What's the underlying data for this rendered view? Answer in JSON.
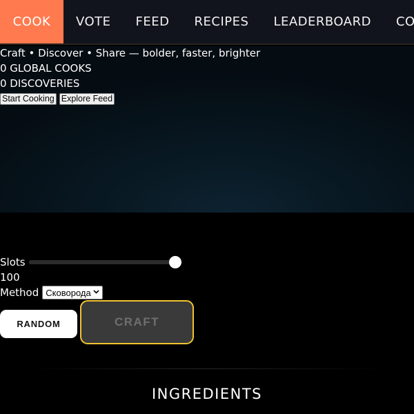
{
  "nav": {
    "tabs": [
      {
        "label": "COOK",
        "active": true
      },
      {
        "label": "VOTE",
        "active": false
      },
      {
        "label": "FEED",
        "active": false
      },
      {
        "label": "RECIPES",
        "active": false
      },
      {
        "label": "LEADERBOARD",
        "active": false
      },
      {
        "label": "COMMUNITY",
        "active": false
      }
    ],
    "active_color": "#ff7a4e"
  },
  "hero": {
    "tagline": "Craft • Discover • Share — bolder, faster, brighter",
    "global_cooks": "0 GLOBAL COOKS",
    "discoveries": "0 DISCOVERIES",
    "start_button": "Start Cooking",
    "explore_button": "Explore Feed"
  },
  "controls": {
    "slots_label": "Slots",
    "slots_value": "100",
    "slots_slider_fraction": 1.0,
    "method_label": "Method",
    "method_selected": "Сковорода",
    "random_button": "RANDOM",
    "craft_button": "CRAFT",
    "craft_border_color": "#f2c431"
  },
  "ingredients": {
    "heading": "INGREDIENTS"
  }
}
